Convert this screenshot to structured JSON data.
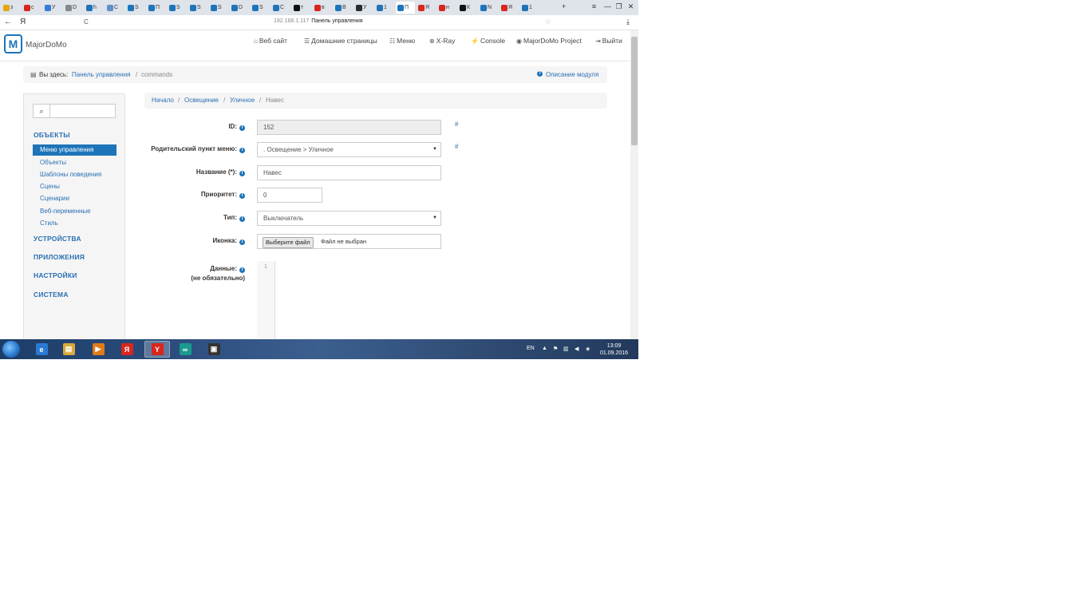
{
  "browser": {
    "tabs": [
      {
        "label": "з",
        "color": "#e8a317"
      },
      {
        "label": "с",
        "color": "#d9261c"
      },
      {
        "label": "У",
        "color": "#3a7bd5"
      },
      {
        "label": "D",
        "color": "#888888"
      },
      {
        "label": "h",
        "color": "#1e74b8"
      },
      {
        "label": "C",
        "color": "#5f8fc7"
      },
      {
        "label": "S",
        "color": "#1e74b8"
      },
      {
        "label": "П",
        "color": "#1e74b8"
      },
      {
        "label": "S",
        "color": "#1e74b8"
      },
      {
        "label": "S",
        "color": "#1e74b8"
      },
      {
        "label": "S",
        "color": "#1e74b8"
      },
      {
        "label": "D",
        "color": "#1e74b8"
      },
      {
        "label": "S",
        "color": "#1e74b8"
      },
      {
        "label": "C",
        "color": "#1e74b8"
      },
      {
        "label": "т",
        "color": "#111111"
      },
      {
        "label": "в",
        "color": "#d9261c"
      },
      {
        "label": "В",
        "color": "#1e74b8"
      },
      {
        "label": "У",
        "color": "#2b2b2b"
      },
      {
        "label": "1",
        "color": "#1e74b8"
      },
      {
        "label": "П",
        "color": "#1e74b8",
        "active": true
      },
      {
        "label": "Я",
        "color": "#d9261c"
      },
      {
        "label": "н",
        "color": "#d9261c"
      },
      {
        "label": "К",
        "color": "#111111"
      },
      {
        "label": "N",
        "color": "#1e74b8"
      },
      {
        "label": "Я",
        "color": "#d9261c"
      },
      {
        "label": "1",
        "color": "#1e74b8"
      }
    ],
    "new_tab": "+",
    "menu_icon": "≡",
    "minimize": "—",
    "restore": "❐",
    "close": "✕",
    "back": "←",
    "yandex_letter": "Я",
    "reload": "C",
    "url_host": "192.168.1.117",
    "url_title": "Панель управления",
    "star": "☆",
    "download": "⤓"
  },
  "site": {
    "logo_letter": "M",
    "brand": "MajorDoMo",
    "nav": [
      {
        "icon": "⌂",
        "label": "Веб сайт"
      },
      {
        "icon": "☰",
        "label": "Домашние страницы"
      },
      {
        "icon": "☷",
        "label": "Меню"
      },
      {
        "icon": "⊗",
        "label": "X-Ray"
      },
      {
        "icon": "⚡",
        "label": "Console"
      },
      {
        "icon": "◉",
        "label": "MajorDoMo Project"
      },
      {
        "icon": "⇥",
        "label": "Выйти"
      }
    ]
  },
  "crumbbar": {
    "prefix": "Вы здесь:",
    "home": "Панель управления",
    "sep": "/",
    "current": "commands",
    "help_icon": "?",
    "help": "Описание модуля"
  },
  "sidebar": {
    "search_icon": "🔍",
    "sections": [
      {
        "label": "ОБЪЕКТЫ"
      },
      {
        "label": "УСТРОЙСТВА"
      },
      {
        "label": "ПРИЛОЖЕНИЯ"
      },
      {
        "label": "НАСТРОЙКИ"
      },
      {
        "label": "СИСТЕМА"
      }
    ],
    "active_item": "Меню управления",
    "items": [
      "Объекты",
      "Шаблоны поведения",
      "Сцены",
      "Сценарии",
      "Веб-переменные",
      "Стиль"
    ]
  },
  "main": {
    "breadcrumb": [
      "Начало",
      "Освещение",
      "Уличное",
      "Навес"
    ],
    "breadcrumb_sep": "/",
    "form": {
      "id_label": "ID:",
      "id_value": "152",
      "parent_label": "Родительский пункт меню:",
      "parent_value": ". Освещение > Уличное",
      "title_label": "Название (*):",
      "title_value": "Навес",
      "priority_label": "Приоритет:",
      "priority_value": "0",
      "type_label": "Тип:",
      "type_value": "Выключатель",
      "icon_label": "Иконка:",
      "icon_button": "Выберите файл",
      "icon_status": "Файл не выбран",
      "data_label": "Данные:",
      "data_hint": "(не обязательно)",
      "line_no": "1",
      "hash": "#",
      "info": "i",
      "caret": "▼"
    }
  },
  "taskbar": {
    "apps": [
      {
        "letter": "e",
        "color": "#2a7ad3"
      },
      {
        "letter": "▤",
        "color": "#d8a93a"
      },
      {
        "letter": "▶",
        "color": "#e07b1a"
      },
      {
        "letter": "Я",
        "color": "#d9261c"
      },
      {
        "letter": "Y",
        "color": "#d9261c",
        "active": true
      },
      {
        "letter": "∞",
        "color": "#1a9a8f"
      },
      {
        "letter": "▣",
        "color": "#333333"
      }
    ],
    "lang": "EN",
    "time": "13:09",
    "date": "01.09.2016"
  }
}
